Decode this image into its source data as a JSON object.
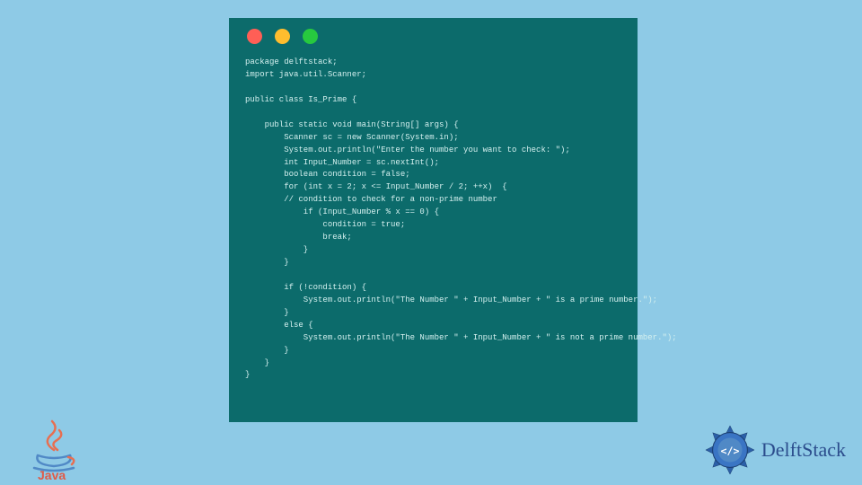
{
  "code": {
    "lines": [
      "package delftstack;",
      "import java.util.Scanner;",
      "",
      "public class Is_Prime {",
      "",
      "    public static void main(String[] args) {",
      "        Scanner sc = new Scanner(System.in);",
      "        System.out.println(\"Enter the number you want to check: \");",
      "        int Input_Number = sc.nextInt();",
      "        boolean condition = false;",
      "        for (int x = 2; x <= Input_Number / 2; ++x)  {",
      "        // condition to check for a non-prime number",
      "            if (Input_Number % x == 0) {",
      "                condition = true;",
      "                break;",
      "            }",
      "        }",
      "",
      "        if (!condition) {",
      "            System.out.println(\"The Number \" + Input_Number + \" is a prime number.\");",
      "        }",
      "        else {",
      "            System.out.println(\"The Number \" + Input_Number + \" is not a prime number.\");",
      "        }",
      "    }",
      "}"
    ]
  },
  "logos": {
    "java_label": "Java",
    "delft_label": "DelftStack"
  }
}
